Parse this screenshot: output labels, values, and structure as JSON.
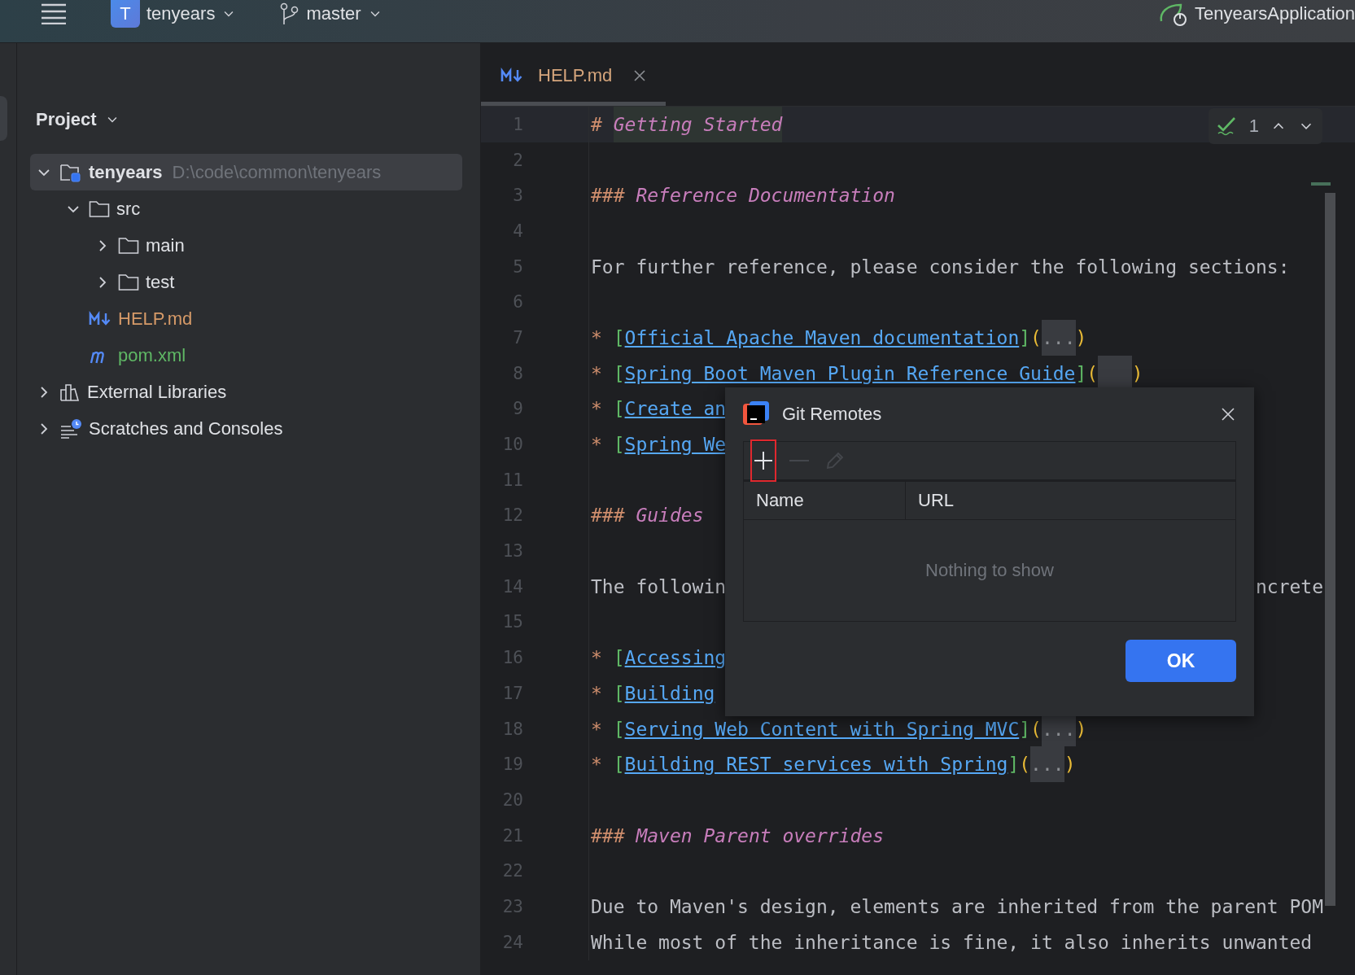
{
  "topbar": {
    "project": {
      "initial": "T",
      "name": "tenyears"
    },
    "branch": "master",
    "run_config": "TenyearsApplication"
  },
  "project_panel": {
    "title": "Project",
    "tree": [
      {
        "label": "tenyears",
        "path": "D:\\code\\common\\tenyears",
        "kind": "module",
        "expanded": true,
        "selected": true,
        "color": "#dfe1e5",
        "children": [
          {
            "label": "src",
            "kind": "folder",
            "expanded": true,
            "selected": false,
            "color": "#dfe1e5",
            "children": [
              {
                "label": "main",
                "kind": "folder",
                "expanded": false,
                "selected": false,
                "color": "#dfe1e5"
              },
              {
                "label": "test",
                "kind": "folder",
                "expanded": false,
                "selected": false,
                "color": "#dfe1e5"
              }
            ]
          },
          {
            "label": "HELP.md",
            "kind": "markdown",
            "selected": false,
            "color": "#d69a68"
          },
          {
            "label": "pom.xml",
            "kind": "maven",
            "selected": false,
            "color": "#5fb865"
          }
        ]
      },
      {
        "label": "External Libraries",
        "kind": "libraries",
        "expanded": false,
        "selected": false,
        "color": "#dfe1e5"
      },
      {
        "label": "Scratches and Consoles",
        "kind": "scratches",
        "expanded": false,
        "selected": false,
        "color": "#dfe1e5"
      }
    ]
  },
  "editor": {
    "tabs": [
      {
        "label": "HELP.md",
        "selected": true
      }
    ],
    "inspection": {
      "count": "1"
    },
    "lines": [
      {
        "number": "1",
        "kind": "heading",
        "current": true,
        "marker": "#",
        "title": "Getting Started"
      },
      {
        "number": "2",
        "kind": "blank",
        "current": false
      },
      {
        "number": "3",
        "kind": "heading",
        "current": false,
        "marker": "###",
        "title": "Reference Documentation"
      },
      {
        "number": "4",
        "kind": "blank",
        "current": false
      },
      {
        "number": "5",
        "kind": "text",
        "current": false,
        "text": "For further reference, please consider the following sections:"
      },
      {
        "number": "6",
        "kind": "blank",
        "current": false
      },
      {
        "number": "7",
        "kind": "link",
        "current": false,
        "bullet": "*",
        "brackets": [
          "[",
          "]"
        ],
        "label": "Official Apache Maven documentation",
        "parens": [
          "(",
          ")"
        ],
        "fold": "..."
      },
      {
        "number": "8",
        "kind": "link",
        "current": false,
        "bullet": "*",
        "brackets": [
          "[",
          "]"
        ],
        "label": "Spring Boot Maven Plugin Reference Guide",
        "parens": [
          "(",
          ")"
        ]
      },
      {
        "number": "9",
        "kind": "link",
        "current": false,
        "bullet": "*",
        "brackets": [
          "["
        ],
        "label": "Create an"
      },
      {
        "number": "10",
        "kind": "link",
        "current": false,
        "bullet": "*",
        "brackets": [
          "["
        ],
        "label": "Spring We"
      },
      {
        "number": "11",
        "kind": "blank",
        "current": false
      },
      {
        "number": "12",
        "kind": "heading",
        "current": false,
        "marker": "###",
        "title": "Guides"
      },
      {
        "number": "13",
        "kind": "blank",
        "current": false
      },
      {
        "number": "14",
        "kind": "text",
        "current": false,
        "text": "The followin",
        "right_text": "ncrete"
      },
      {
        "number": "15",
        "kind": "blank",
        "current": false
      },
      {
        "number": "16",
        "kind": "link",
        "current": false,
        "bullet": "*",
        "brackets": [
          "["
        ],
        "label": "Accessing"
      },
      {
        "number": "17",
        "kind": "link",
        "current": false,
        "bullet": "*",
        "brackets": [
          "["
        ],
        "label": "Building"
      },
      {
        "number": "18",
        "kind": "link",
        "current": false,
        "bullet": "*",
        "brackets": [
          "[",
          "]"
        ],
        "label": "Serving Web Content with Spring MVC",
        "parens": [
          "(",
          ")"
        ],
        "fold": "..."
      },
      {
        "number": "19",
        "kind": "link",
        "current": false,
        "bullet": "*",
        "brackets": [
          "[",
          "]"
        ],
        "label": "Building REST services with Spring",
        "parens": [
          "(",
          ")"
        ],
        "fold": "..."
      },
      {
        "number": "20",
        "kind": "blank",
        "current": false
      },
      {
        "number": "21",
        "kind": "heading",
        "current": false,
        "marker": "###",
        "title": "Maven Parent overrides"
      },
      {
        "number": "22",
        "kind": "blank",
        "current": false
      },
      {
        "number": "23",
        "kind": "text",
        "current": false,
        "text": "Due to Maven's design, elements are inherited from the parent POM"
      },
      {
        "number": "24",
        "kind": "text",
        "current": false,
        "text": "While most of the inheritance is fine, it also inherits unwanted"
      }
    ]
  },
  "dialog": {
    "title": "Git Remotes",
    "toolbar": [
      {
        "kind": "add",
        "disabled": false,
        "highlighted": true
      },
      {
        "kind": "remove",
        "disabled": true,
        "highlighted": false
      },
      {
        "kind": "edit",
        "disabled": true,
        "highlighted": false
      }
    ],
    "columns": [
      "Name",
      "URL"
    ],
    "empty_text": "Nothing to show",
    "ok": "OK"
  }
}
